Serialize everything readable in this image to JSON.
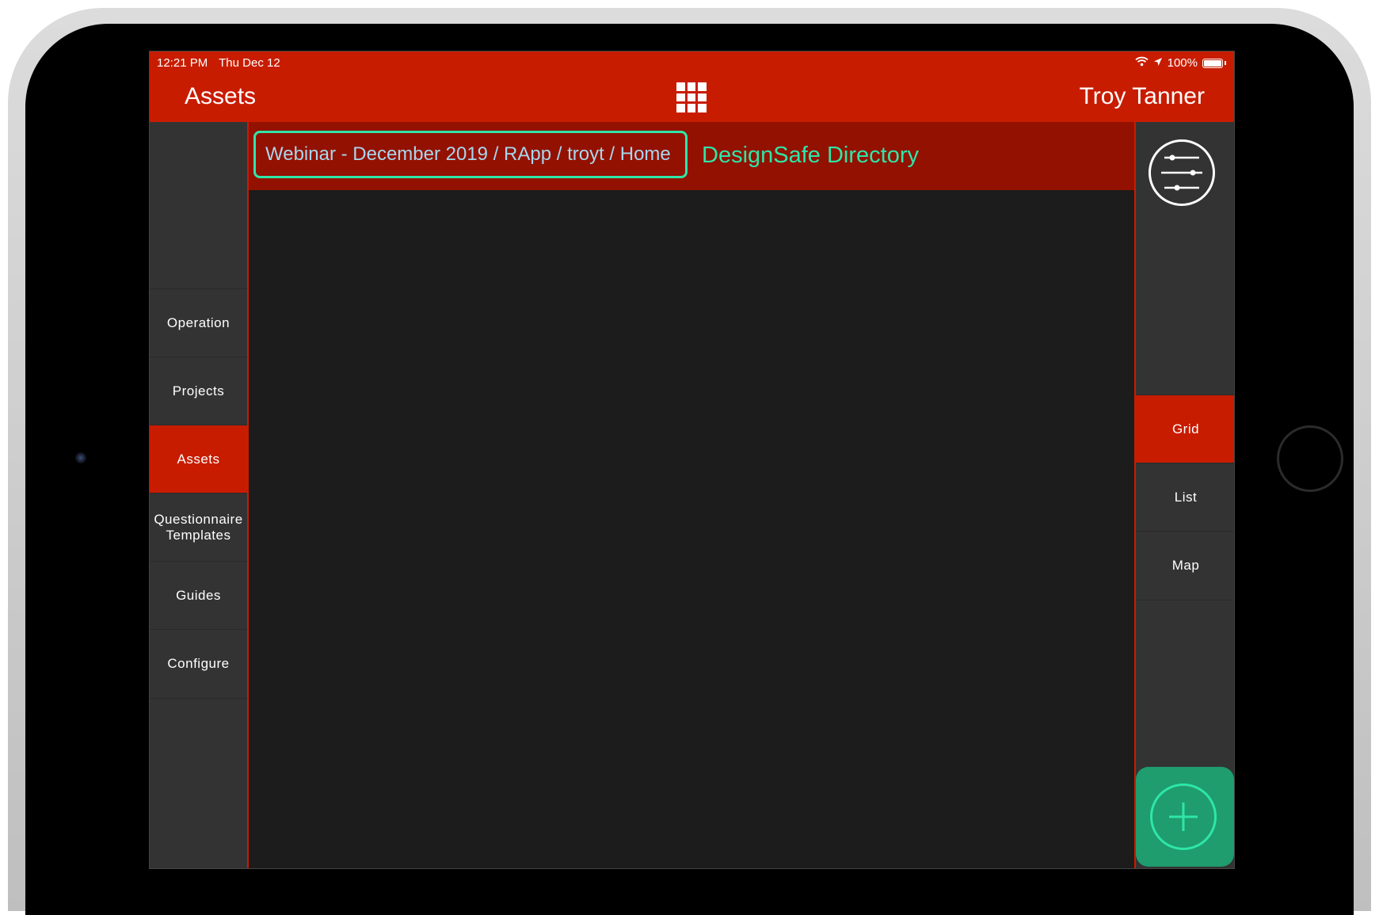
{
  "status_bar": {
    "time": "12:21 PM",
    "date": "Thu Dec 12",
    "battery": "100%"
  },
  "nav": {
    "title": "Assets",
    "user": "Troy Tanner"
  },
  "sidebar": {
    "items": [
      {
        "label": "Operation",
        "active": false
      },
      {
        "label": "Projects",
        "active": false
      },
      {
        "label": "Assets",
        "active": true
      },
      {
        "label": "Questionnaire Templates",
        "active": false
      },
      {
        "label": "Guides",
        "active": false
      },
      {
        "label": "Configure",
        "active": false
      }
    ]
  },
  "main": {
    "breadcrumb": "Webinar - December 2019 / RApp / troyt / Home",
    "directory_label": "DesignSafe Directory"
  },
  "views": {
    "items": [
      {
        "label": "Grid",
        "active": true
      },
      {
        "label": "List",
        "active": false
      },
      {
        "label": "Map",
        "active": false
      }
    ]
  },
  "colors": {
    "accent_red": "#c81c00",
    "header_dark_red": "#931100",
    "highlight_green": "#2ee6a8",
    "add_button_green": "#1f9d6e"
  }
}
